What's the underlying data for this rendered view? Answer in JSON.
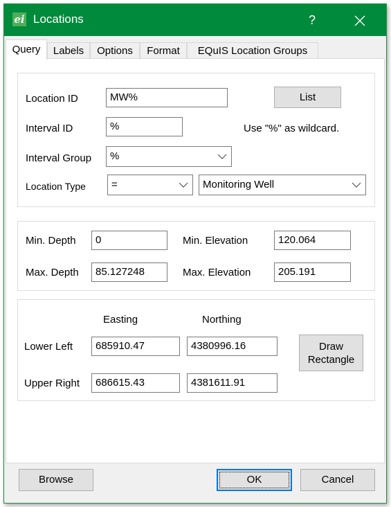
{
  "window": {
    "title": "Locations",
    "app_icon": "ei-app-icon",
    "help_label": "?",
    "close_icon": "close-icon"
  },
  "tabs": [
    {
      "label": "Query",
      "active": true
    },
    {
      "label": "Labels",
      "active": false
    },
    {
      "label": "Options",
      "active": false
    },
    {
      "label": "Format",
      "active": false
    },
    {
      "label": "EQuIS Location Groups",
      "active": false
    }
  ],
  "query": {
    "location_id": {
      "label": "Location ID",
      "value": "MW%"
    },
    "list_button": "List",
    "interval_id": {
      "label": "Interval ID",
      "value": "%"
    },
    "wildcard_hint": "Use \"%\" as wildcard.",
    "interval_group": {
      "label": "Interval Group",
      "value": "%"
    },
    "location_type": {
      "label": "Location Type",
      "operator": "=",
      "value": "Monitoring Well"
    }
  },
  "depth": {
    "min_depth": {
      "label": "Min. Depth",
      "value": "0"
    },
    "max_depth": {
      "label": "Max. Depth",
      "value": "85.127248"
    },
    "min_elevation": {
      "label": "Min. Elevation",
      "value": "120.064"
    },
    "max_elevation": {
      "label": "Max. Elevation",
      "value": "205.191"
    }
  },
  "extent": {
    "easting_header": "Easting",
    "northing_header": "Northing",
    "lower_left": {
      "label": "Lower Left",
      "easting": "685910.47",
      "northing": "4380996.16"
    },
    "upper_right": {
      "label": "Upper Right",
      "easting": "686615.43",
      "northing": "4381611.91"
    },
    "draw_rectangle_line1": "Draw",
    "draw_rectangle_line2": "Rectangle"
  },
  "footer": {
    "browse": "Browse",
    "ok": "OK",
    "cancel": "Cancel"
  }
}
